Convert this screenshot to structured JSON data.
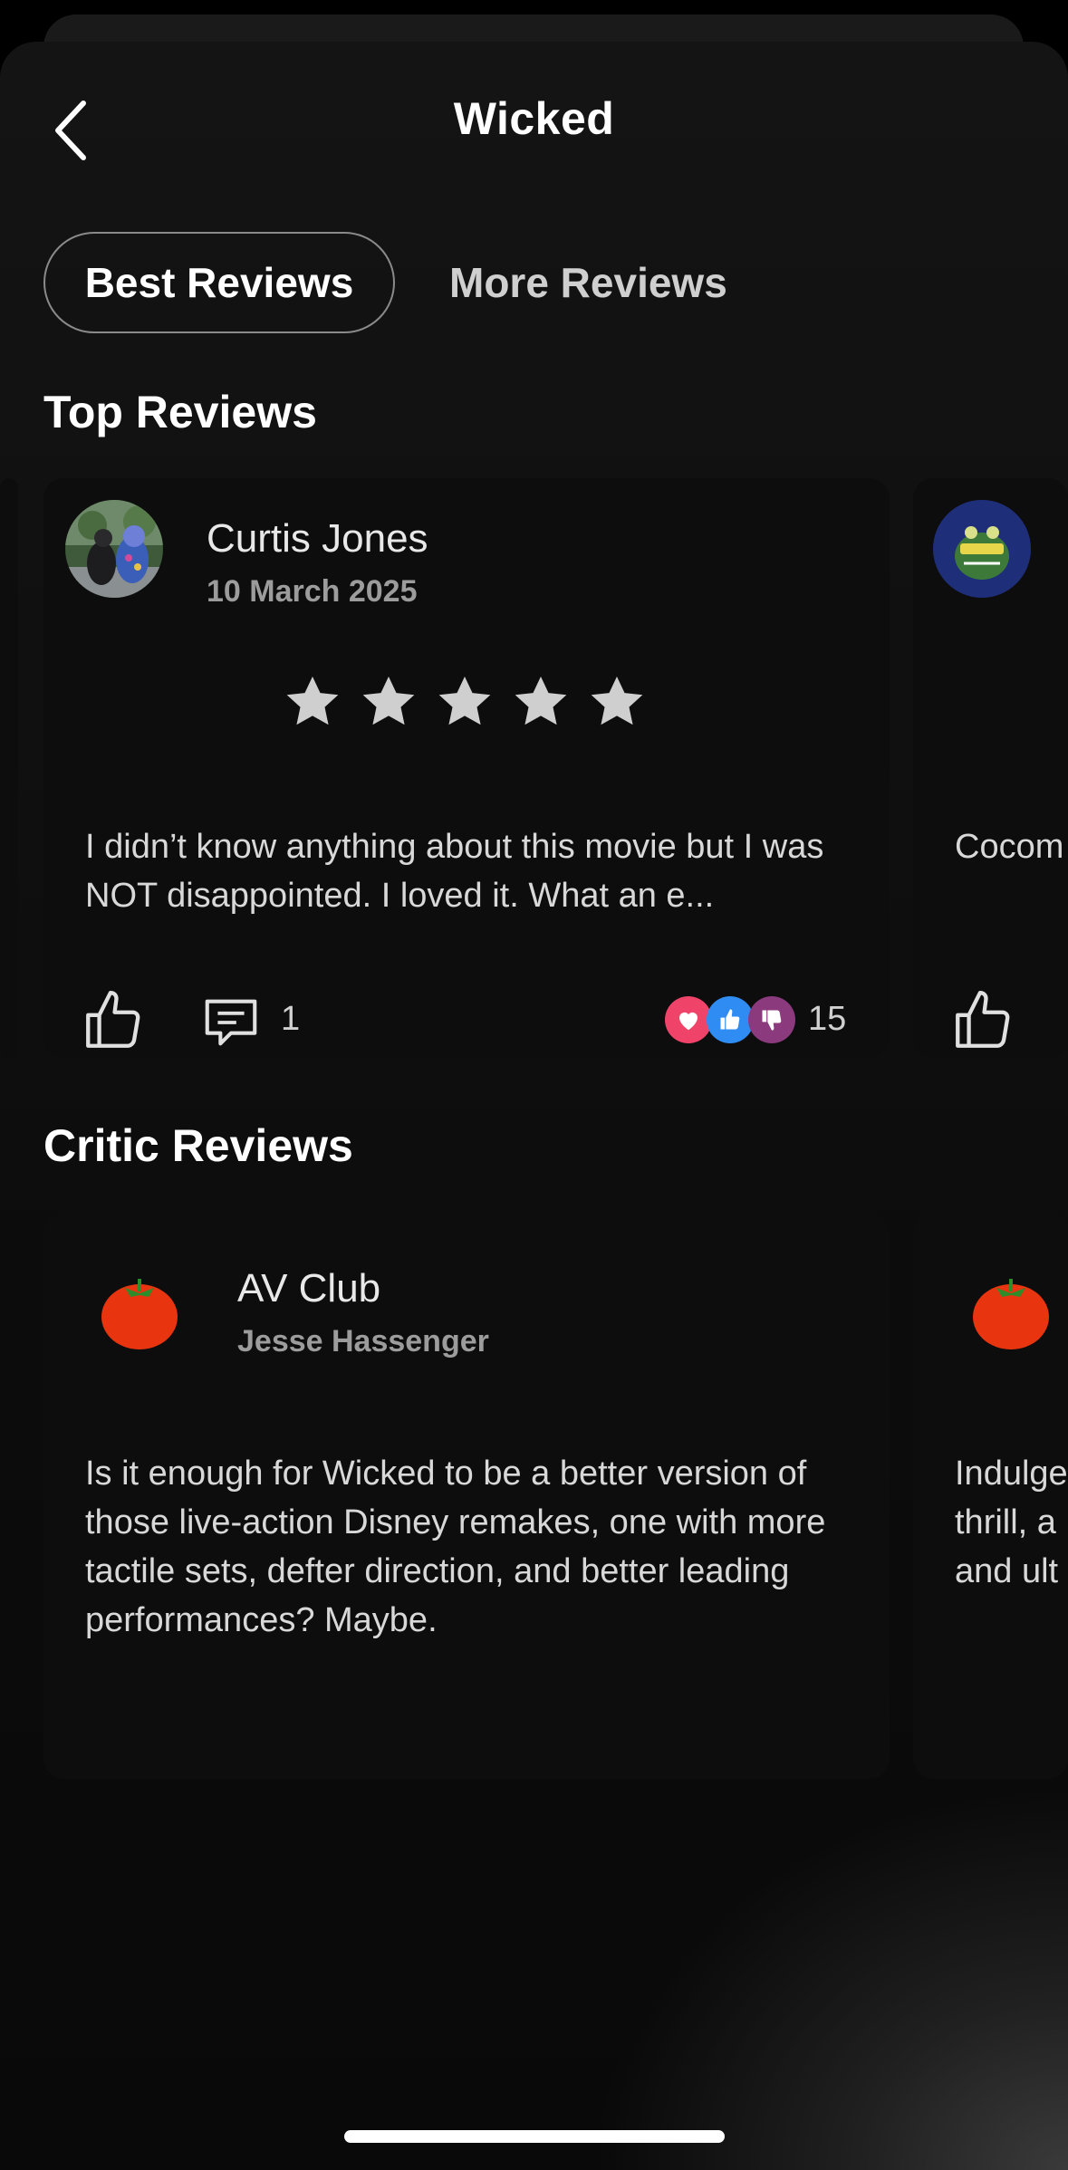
{
  "header": {
    "title": "Wicked"
  },
  "tabs": [
    {
      "label": "Best Reviews",
      "selected": true
    },
    {
      "label": "More Reviews",
      "selected": false
    }
  ],
  "top_reviews": {
    "heading": "Top Reviews",
    "cards": [
      {
        "author": "Curtis Jones",
        "date": "10 March 2025",
        "rating": 5,
        "text": "I didn’t know anything about this movie but I was NOT disappointed. I loved it. What an e...",
        "comment_count": "1",
        "reaction_count": "15"
      },
      {
        "text": "Cocom"
      }
    ]
  },
  "critic_reviews": {
    "heading": "Critic Reviews",
    "cards": [
      {
        "outlet": "AV Club",
        "critic": "Jesse Hassenger",
        "text": "Is it enough for Wicked to be a better version of those live-action Disney remakes, one with more tactile sets, defter direction, and better leading performances? Maybe."
      },
      {
        "text_lines": [
          "Indulge",
          "thrill, a",
          "and ult"
        ]
      }
    ]
  },
  "colors": {
    "heart": "#f0436a",
    "like": "#2f8cf2",
    "dislike": "#8b3a7e",
    "tomato": "#e8350f",
    "star": "#cfcfcf"
  }
}
